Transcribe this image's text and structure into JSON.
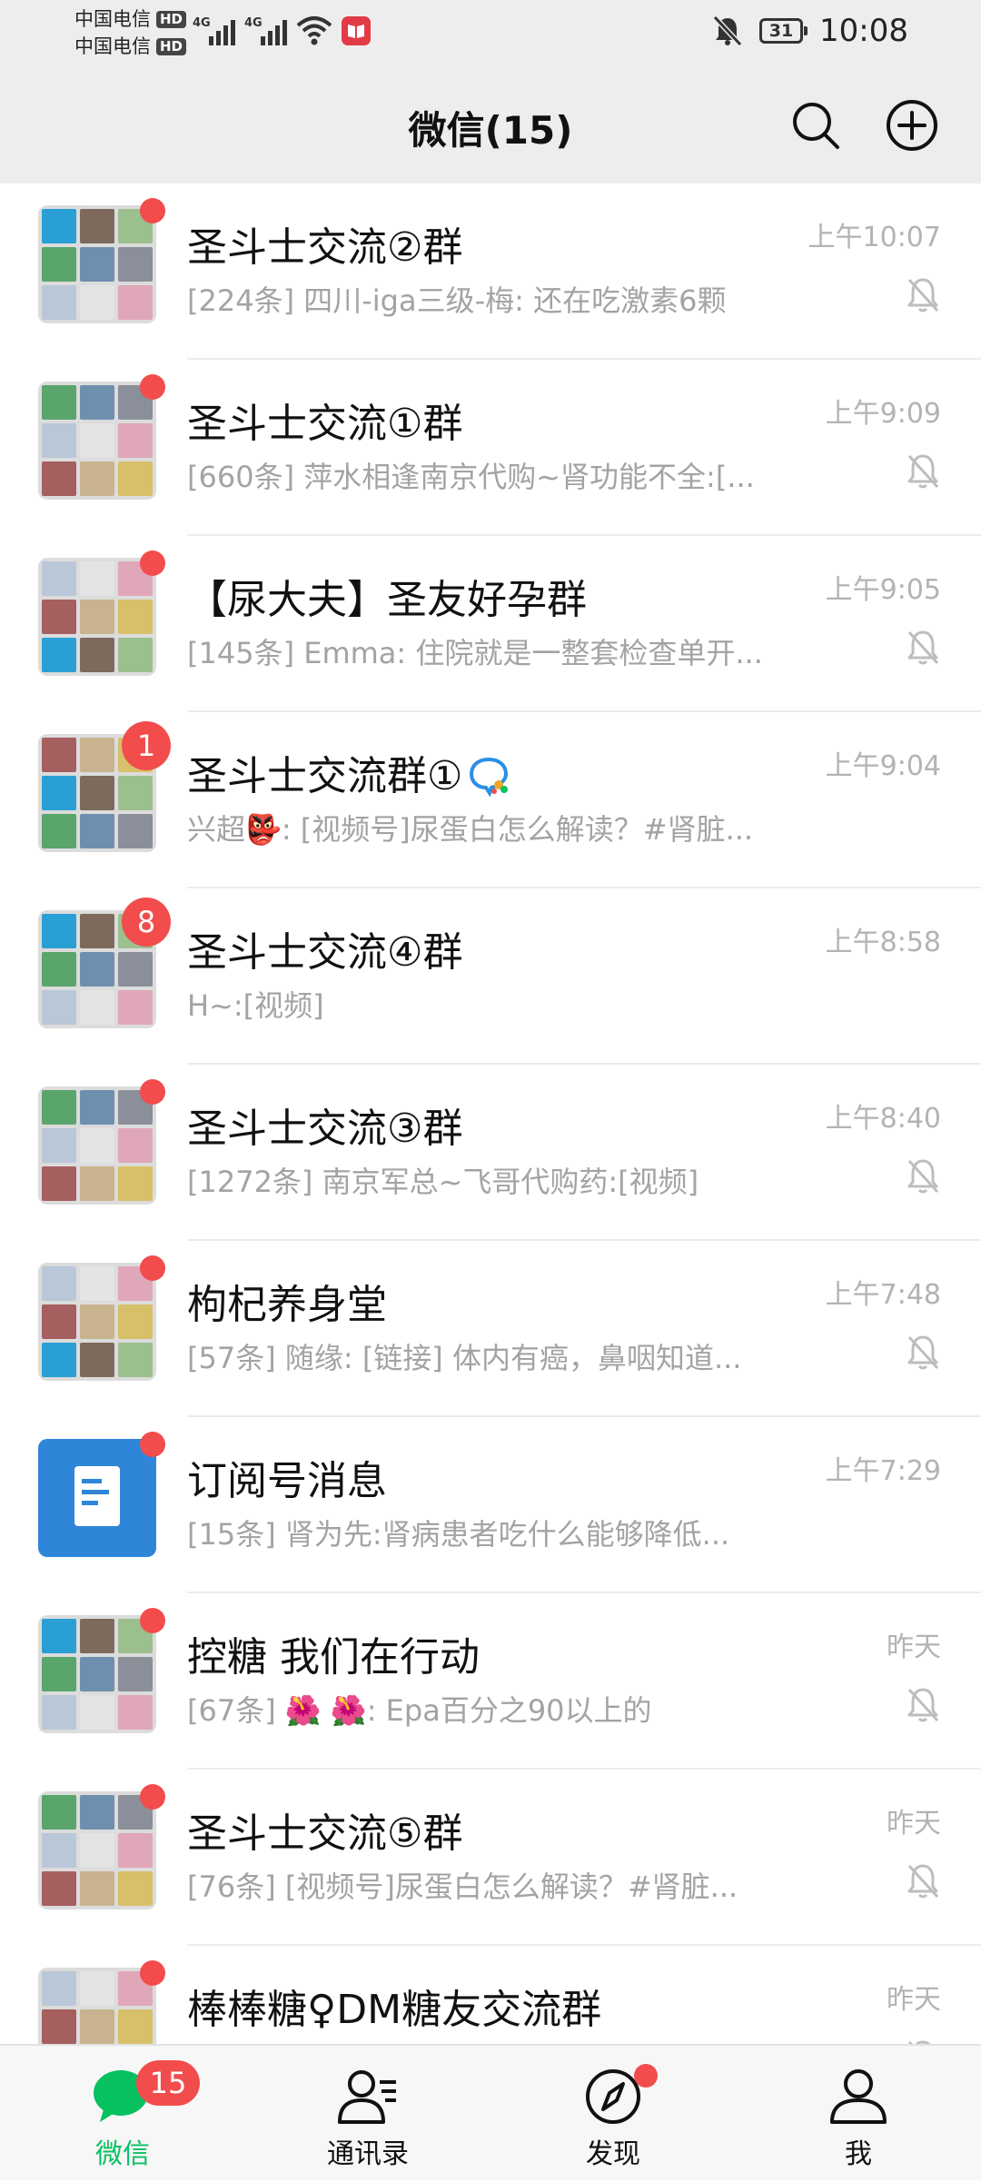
{
  "status_bar": {
    "carriers": [
      {
        "name": "中国电信",
        "tag": "HD"
      },
      {
        "name": "中国电信",
        "tag": "HD"
      }
    ],
    "network_labels": [
      "4G",
      "4G"
    ],
    "battery": "31",
    "time": "10:08"
  },
  "header": {
    "title": "微信(15)"
  },
  "chats": [
    {
      "title": "圣斗士交流②群",
      "preview": "[224条] 四川-iga三级-梅: 还在吃激素6颗",
      "time": "上午10:07",
      "muted": true,
      "badge": "dot"
    },
    {
      "title": "圣斗士交流①群",
      "preview": "[660条] 萍水相逢南京代购~肾功能不全:[...",
      "time": "上午9:09",
      "muted": true,
      "badge": "dot"
    },
    {
      "title": "【尿大夫】圣友好孕群",
      "preview": "[145条] Emma: 住院就是一整套检查单开...",
      "time": "上午9:05",
      "muted": true,
      "badge": "dot"
    },
    {
      "title": "圣斗士交流群①",
      "preview": "兴超👺: [视频号]尿蛋白怎么解读？#肾脏...",
      "time": "上午9:04",
      "muted": false,
      "badge": "1",
      "has_bubble_icon": true
    },
    {
      "title": "圣斗士交流④群",
      "preview": "H~:[视频]",
      "time": "上午8:58",
      "muted": false,
      "badge": "8"
    },
    {
      "title": "圣斗士交流③群",
      "preview": "[1272条] 南京军总~飞哥代购药:[视频]",
      "time": "上午8:40",
      "muted": true,
      "badge": "dot"
    },
    {
      "title": "枸杞养身堂",
      "preview": "[57条] 随缘: [链接] 体内有癌，鼻咽知道...",
      "time": "上午7:48",
      "muted": true,
      "badge": "dot"
    },
    {
      "title": "订阅号消息",
      "preview": "[15条] 肾为先:肾病患者吃什么能够降低...",
      "time": "上午7:29",
      "muted": false,
      "badge": "dot",
      "single_avatar": true
    },
    {
      "title": "控糖 我们在行动",
      "preview": "[67条] 🌺 🌺: Epa百分之90以上的",
      "time": "昨天",
      "muted": true,
      "badge": "dot"
    },
    {
      "title": "圣斗士交流⑤群",
      "preview": "[76条] [视频号]尿蛋白怎么解读？#肾脏...",
      "time": "昨天",
      "muted": true,
      "badge": "dot"
    },
    {
      "title": "棒棒糖♀DM糖友交流群",
      "preview": "",
      "time": "昨天",
      "muted": true,
      "badge": "dot"
    }
  ],
  "tabbar": {
    "tabs": [
      {
        "label": "微信",
        "icon": "chat-bubble-icon",
        "badge": "15",
        "active": true
      },
      {
        "label": "通讯录",
        "icon": "contacts-icon"
      },
      {
        "label": "发现",
        "icon": "compass-icon",
        "dot": true
      },
      {
        "label": "我",
        "icon": "person-icon"
      }
    ]
  },
  "colors": {
    "accent": "#07c160",
    "badge": "#f24c4c",
    "header_bg": "#ededed",
    "tabbar_bg": "#f7f7f7"
  }
}
